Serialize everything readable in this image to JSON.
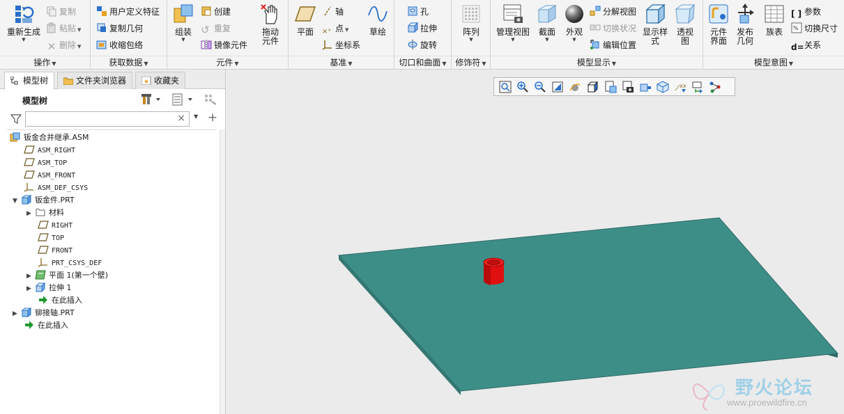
{
  "ribbon": {
    "groups": {
      "operations": "操作",
      "get_data": "获取数据",
      "component": "元件",
      "datum": "基准",
      "cut_surface": "切口和曲面",
      "modifiers": "修饰符",
      "model_display": "模型显示",
      "model_intent": "模型意图"
    },
    "operations": {
      "regenerate": "重新生成",
      "copy": "复制",
      "paste": "粘贴",
      "delete": "删除"
    },
    "get_data": {
      "udf": "用户定义特征",
      "copy_geom": "复制几何",
      "shrinkwrap": "收缩包络"
    },
    "component": {
      "assemble": "组装",
      "create": "创建",
      "repeat": "重复",
      "mirror": "镜像元件",
      "drag": "拖动元件"
    },
    "datum": {
      "plane": "平面",
      "axis": "轴",
      "point": "点",
      "csys": "坐标系",
      "sketch": "草绘"
    },
    "cut_surface": {
      "hole": "孔",
      "extrude": "拉伸",
      "revolve": "旋转"
    },
    "modifiers": {
      "pattern": "阵列"
    },
    "model_display": {
      "manage_views": "管理视图",
      "section": "截面",
      "appearance": "外观",
      "explode": "分解视图",
      "toggle_status": "切换状况",
      "edit_position": "编辑位置",
      "display_style": "显示样式",
      "perspective": "透视图"
    },
    "model_intent": {
      "comp_interface": "元件界面",
      "publish_geom": "发布几何",
      "family_table": "族表",
      "params": "参数",
      "switch_dims": "切换尺寸",
      "relations": "关系"
    }
  },
  "leftpane": {
    "tabs": [
      "模型树",
      "文件夹浏览器",
      "收藏夹"
    ],
    "title": "模型树",
    "filter_placeholder": "",
    "tree": {
      "asm": "钣金合并继承.ASM",
      "asm_right": "ASM_RIGHT",
      "asm_top": "ASM_TOP",
      "asm_front": "ASM_FRONT",
      "asm_csys": "ASM_DEF_CSYS",
      "part1": "钣金件.PRT",
      "material": "材料",
      "right": "RIGHT",
      "top": "TOP",
      "front": "FRONT",
      "prt_csys": "PRT_CSYS_DEF",
      "planar": "平面 1(第一个壁)",
      "extrude": "拉伸 1",
      "insert_here_1": "在此插入",
      "part2": "铆接轴.PRT",
      "insert_here_2": "在此插入"
    }
  },
  "graphics": {
    "plate_color": "#3e8e88",
    "rivet_color": "#e01010"
  },
  "watermark": {
    "title": "野火论坛",
    "url": "www.proewildfire.cn"
  },
  "colors": {
    "accent_blue": "#2a6fc9",
    "icon_green": "#2e9a3e"
  }
}
